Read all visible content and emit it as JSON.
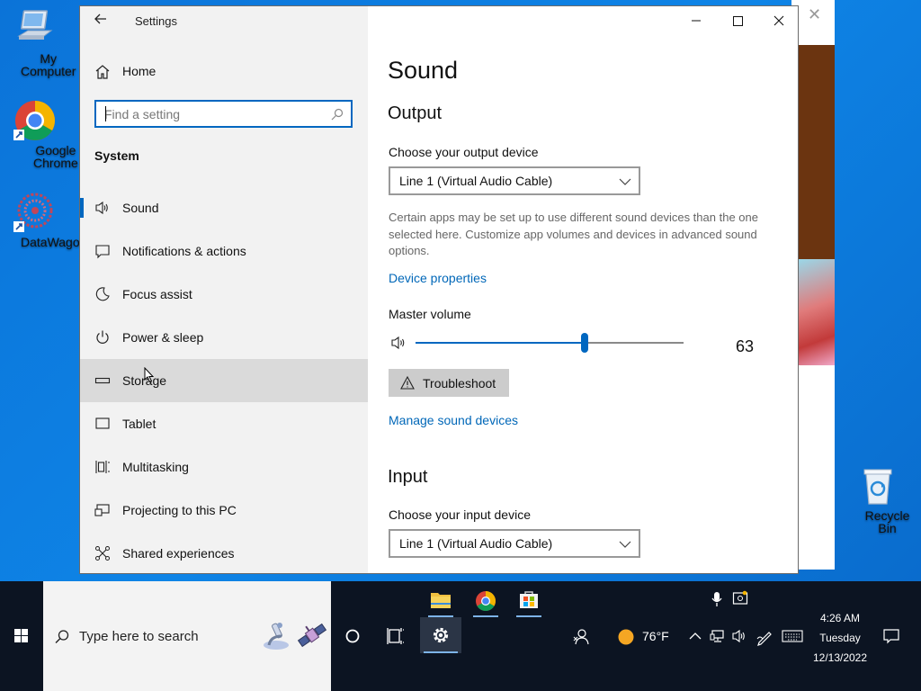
{
  "desktop": {
    "icons": [
      {
        "label": "My Computer"
      },
      {
        "label": "Google Chrome"
      },
      {
        "label": "DataWagon..."
      },
      {
        "label": "Recycle Bin"
      }
    ]
  },
  "settings": {
    "app_title": "Settings",
    "home_label": "Home",
    "search_placeholder": "Find a setting",
    "section_header": "System",
    "nav_items": [
      {
        "label": "Sound",
        "icon": "speaker-icon",
        "selected": true
      },
      {
        "label": "Notifications & actions",
        "icon": "message-icon"
      },
      {
        "label": "Focus assist",
        "icon": "moon-icon"
      },
      {
        "label": "Power & sleep",
        "icon": "power-icon"
      },
      {
        "label": "Storage",
        "icon": "storage-icon",
        "hovered": true
      },
      {
        "label": "Tablet",
        "icon": "tablet-icon"
      },
      {
        "label": "Multitasking",
        "icon": "multitasking-icon"
      },
      {
        "label": "Projecting to this PC",
        "icon": "projector-icon"
      },
      {
        "label": "Shared experiences",
        "icon": "shared-icon"
      }
    ],
    "page_title": "Sound",
    "output": {
      "heading": "Output",
      "device_label": "Choose your output device",
      "device_value": "Line 1 (Virtual Audio Cable)",
      "description": "Certain apps may be set up to use different sound devices than the one selected here. Customize app volumes and devices in advanced sound options.",
      "device_properties_link": "Device properties",
      "master_volume_label": "Master volume",
      "volume": 63,
      "troubleshoot_label": "Troubleshoot",
      "manage_link": "Manage sound devices"
    },
    "input": {
      "heading": "Input",
      "device_label": "Choose your input device",
      "device_value": "Line 1 (Virtual Audio Cable)"
    }
  },
  "taskbar": {
    "search_placeholder": "Type here to search",
    "weather": "76°F",
    "time": "4:26 AM",
    "day": "Tuesday",
    "date": "12/13/2022"
  },
  "colors": {
    "accent": "#0067c0",
    "link": "#0067b8",
    "desktop": "#0b73d8",
    "taskbar": "#0c1422"
  }
}
